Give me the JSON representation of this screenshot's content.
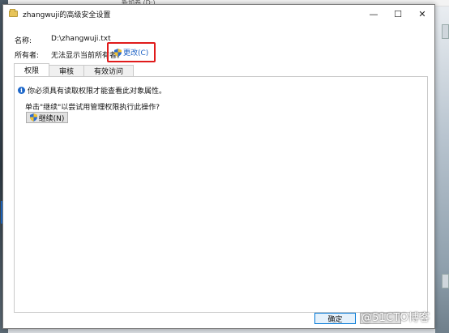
{
  "background": {
    "top_hint": "新加卷 (D:)"
  },
  "window": {
    "title": "zhangwuji的高级安全设置",
    "minimize": "—",
    "maximize": "☐",
    "close": "✕"
  },
  "fields": {
    "name_label": "名称:",
    "name_value": "D:\\zhangwuji.txt",
    "owner_label": "所有者:",
    "owner_value": "无法显示当前所有者。",
    "change_link": "更改(C)"
  },
  "tabs": [
    {
      "label": "权限",
      "active": true
    },
    {
      "label": "审核",
      "active": false
    },
    {
      "label": "有效访问",
      "active": false
    }
  ],
  "panel": {
    "info_text": "你必须具有读取权限才能查看此对象属性。",
    "hint_text": "单击\"继续\"以尝试用管理权限执行此操作?",
    "continue_button": "继续(N)"
  },
  "footer": {
    "ok_button": "确定",
    "cancel_button": ""
  },
  "watermark": "@51CTO博客",
  "colors": {
    "link": "#1a5fc4",
    "highlight": "#e01b1b",
    "info": "#1d67c9"
  }
}
